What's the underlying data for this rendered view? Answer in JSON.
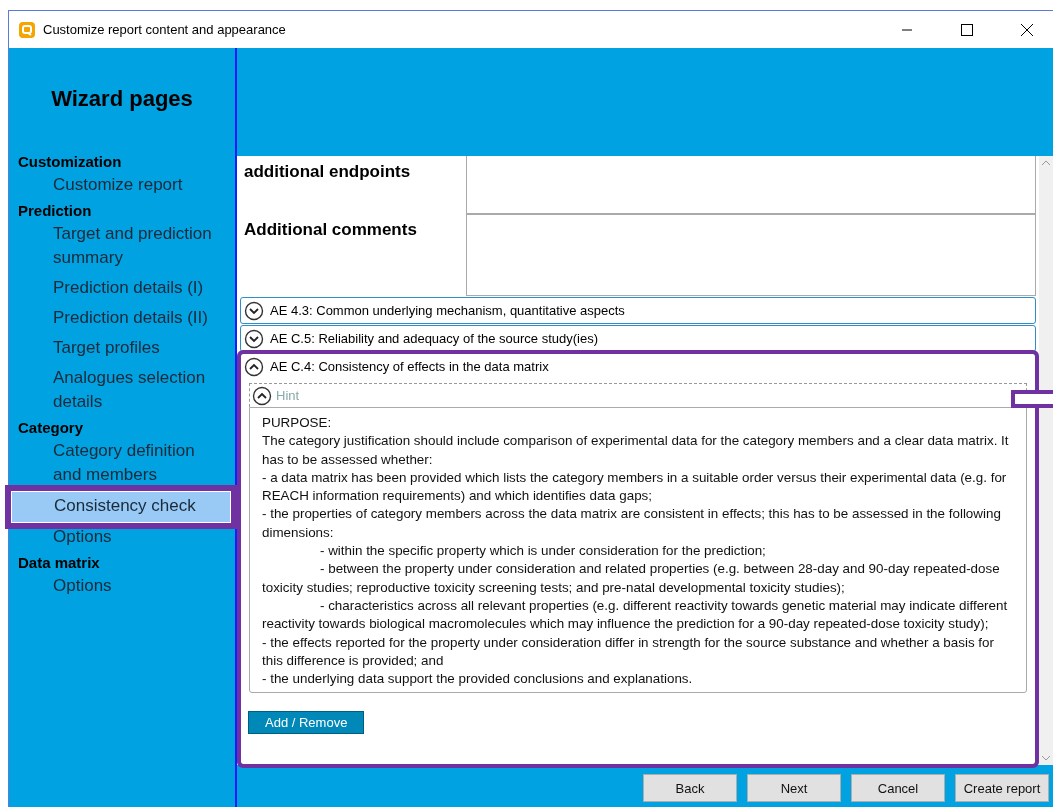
{
  "window": {
    "title": "Customize report content and appearance"
  },
  "sidebar": {
    "title": "Wizard pages",
    "groups": [
      {
        "label": "Customization",
        "items": [
          {
            "label": "Customize report",
            "selected": false
          }
        ]
      },
      {
        "label": "Prediction",
        "items": [
          {
            "label": "Target and prediction summary",
            "selected": false
          },
          {
            "label": "Prediction details (I)",
            "selected": false
          },
          {
            "label": "Prediction details (II)",
            "selected": false
          },
          {
            "label": "Target profiles",
            "selected": false
          },
          {
            "label": "Analogues selection details",
            "selected": false
          }
        ]
      },
      {
        "label": "Category",
        "items": [
          {
            "label": "Category definition and members",
            "selected": false
          },
          {
            "label": "Consistency check",
            "selected": true
          },
          {
            "label": "Options",
            "selected": false
          }
        ]
      },
      {
        "label": "Data matrix",
        "items": [
          {
            "label": "Options",
            "selected": false
          }
        ]
      }
    ]
  },
  "fields": [
    {
      "label": "additional endpoints"
    },
    {
      "label": "Additional comments"
    }
  ],
  "sections": [
    {
      "title": "AE 4.3:  Common underlying mechanism, quantitative aspects",
      "expanded": false
    },
    {
      "title": "AE C.5:  Reliability and adequacy of the source study(ies)",
      "expanded": false
    },
    {
      "title": "AE C.4:  Consistency of effects in the data matrix",
      "expanded": true,
      "hint": {
        "label": "Hint",
        "expanded": true,
        "lines": [
          {
            "kind": "plain",
            "text": "PURPOSE:"
          },
          {
            "kind": "plain",
            "text": "The category justification should include comparison of experimental data for the category members and a clear data matrix. It has to be assessed whether:"
          },
          {
            "kind": "plain",
            "text": "- a data matrix has been provided which lists the category members in a suitable order versus their experimental data (e.g. for REACH information requirements) and which identifies data gaps;"
          },
          {
            "kind": "plain",
            "text": "- the properties of category members across the data matrix are consistent in effects; this has to be assessed in the following dimensions:"
          },
          {
            "kind": "indented",
            "text": "- within the specific property which is under consideration for the prediction;"
          },
          {
            "kind": "indented",
            "text": "- between the property under consideration and related properties (e.g. between 28-day and 90-day repeated-dose toxicity studies; reproductive toxicity screening tests; and pre-natal developmental toxicity studies);"
          },
          {
            "kind": "indented",
            "text": "- characteristics across all relevant properties (e.g. different reactivity towards genetic material may indicate different reactivity towards biological macromolecules which may influence the prediction for a 90-day repeated-dose toxicity study);"
          },
          {
            "kind": "plain",
            "text": "- the effects reported for the property under consideration differ in strength for the source substance and whether a basis for this difference is provided; and"
          },
          {
            "kind": "plain",
            "text": "- the underlying data support the provided conclusions and explanations."
          }
        ]
      },
      "button": "Add / Remove"
    }
  ],
  "buttons": [
    "Back",
    "Next",
    "Cancel",
    "Create report"
  ]
}
